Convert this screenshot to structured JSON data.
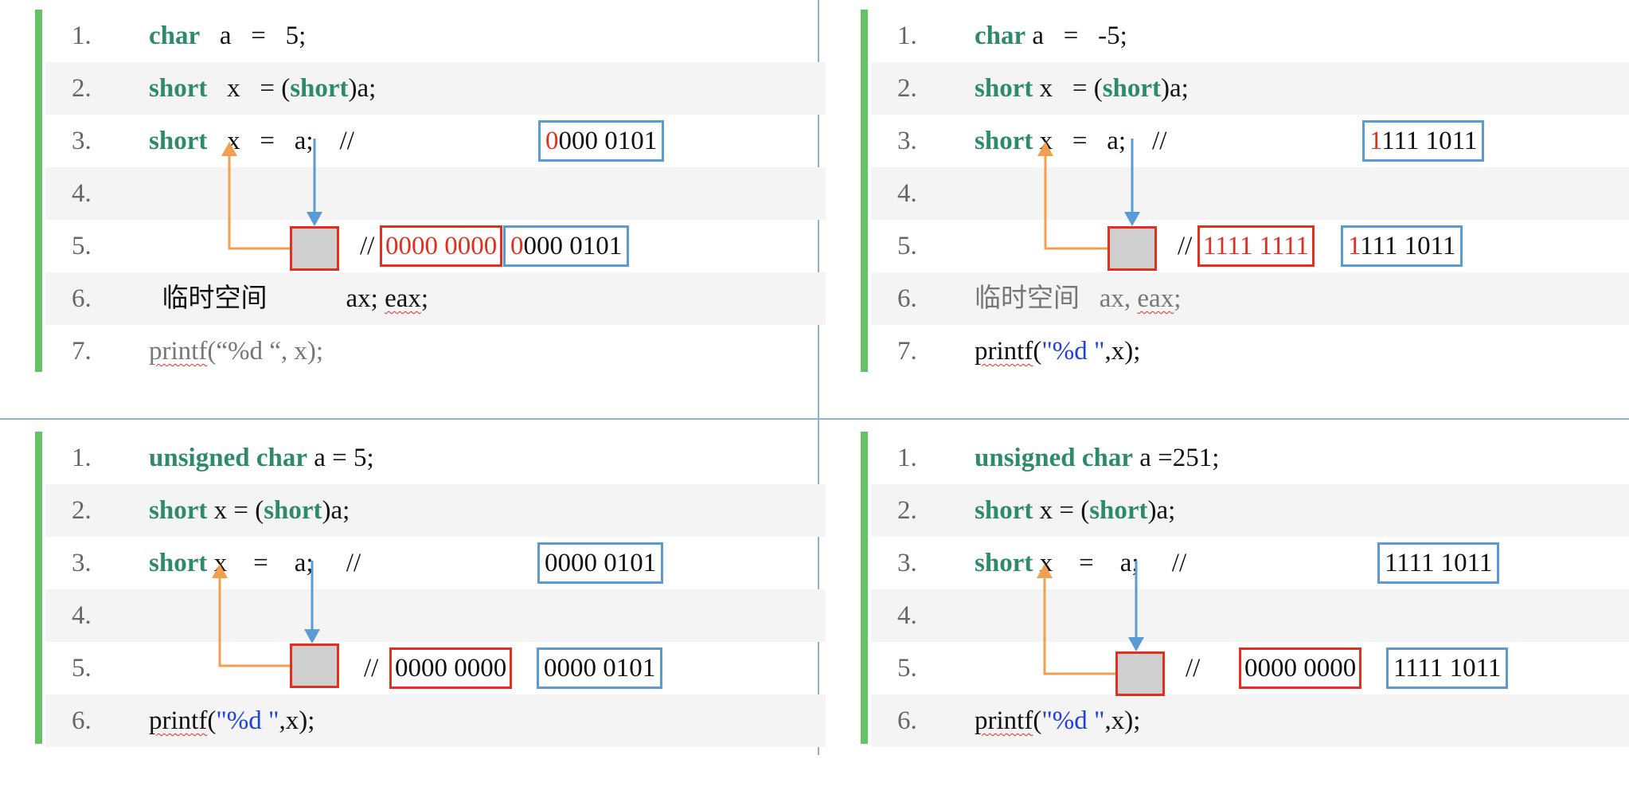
{
  "panels": [
    {
      "lines": [
        {
          "n": "1.",
          "parts": [
            {
              "t": "char",
              "k": "kw"
            },
            {
              "t": "   a   =   5;"
            }
          ]
        },
        {
          "n": "2.",
          "parts": [
            {
              "t": "short",
              "k": "kw"
            },
            {
              "t": "   x   = ("
            },
            {
              "t": "short",
              "k": "kw"
            },
            {
              "t": ")a;"
            }
          ]
        },
        {
          "n": "3.",
          "parts": [
            {
              "t": "short",
              "k": "kw"
            },
            {
              "t": "   x   =   a;    //"
            }
          ]
        },
        {
          "n": "4.",
          "parts": []
        },
        {
          "n": "5.",
          "parts": [
            {
              "t": "//"
            }
          ]
        },
        {
          "n": "6.",
          "parts": [
            {
              "t": "  临时空间            ax; "
            },
            {
              "t": "eax",
              "k": "wavy"
            },
            {
              "t": ";"
            }
          ]
        },
        {
          "n": "7.",
          "parts": [
            {
              "t": "printf",
              "k": "gray wavy"
            },
            {
              "t": "(“%d “, x);",
              "k": "gray"
            }
          ]
        }
      ],
      "line3_box": [
        {
          "t": "0",
          "c": "red"
        },
        {
          "t": "000 0101"
        }
      ],
      "line5_red_box": "0000 0000",
      "line5_blue_box": [
        {
          "t": "0",
          "c": "red"
        },
        {
          "t": "000 0101"
        }
      ]
    },
    {
      "lines": [
        {
          "n": "1.",
          "parts": [
            {
              "t": "char",
              "k": "kw"
            },
            {
              "t": " a   =   -5;"
            }
          ]
        },
        {
          "n": "2.",
          "parts": [
            {
              "t": "short",
              "k": "kw"
            },
            {
              "t": " x   = ("
            },
            {
              "t": "short",
              "k": "kw"
            },
            {
              "t": ")a;"
            }
          ]
        },
        {
          "n": "3.",
          "parts": [
            {
              "t": "short",
              "k": "kw"
            },
            {
              "t": " x   =   a;    //"
            }
          ]
        },
        {
          "n": "4.",
          "parts": []
        },
        {
          "n": "5.",
          "parts": [
            {
              "t": "//"
            }
          ]
        },
        {
          "n": "6.",
          "parts": [
            {
              "t": "临时空间   ax, ",
              "k": "gray"
            },
            {
              "t": "eax",
              "k": "gray wavy"
            },
            {
              "t": ";",
              "k": "gray"
            }
          ]
        },
        {
          "n": "7.",
          "parts": [
            {
              "t": "printf",
              "k": "wavy"
            },
            {
              "t": "("
            },
            {
              "t": "\"%d \"",
              "k": "str"
            },
            {
              "t": ",x);"
            }
          ]
        }
      ],
      "line3_box": [
        {
          "t": "1",
          "c": "red"
        },
        {
          "t": "111 1011"
        }
      ],
      "line5_red_box": "1111 1111",
      "line5_blue_box": [
        {
          "t": "1",
          "c": "red"
        },
        {
          "t": "111 1011"
        }
      ]
    },
    {
      "lines": [
        {
          "n": "1.",
          "parts": [
            {
              "t": "unsigned char",
              "k": "kw"
            },
            {
              "t": " a = 5;"
            }
          ]
        },
        {
          "n": "2.",
          "parts": [
            {
              "t": "short",
              "k": "kw"
            },
            {
              "t": " x = ("
            },
            {
              "t": "short",
              "k": "kw"
            },
            {
              "t": ")a;"
            }
          ]
        },
        {
          "n": "3.",
          "parts": [
            {
              "t": "short",
              "k": "kw"
            },
            {
              "t": " x    =    a;     //"
            }
          ]
        },
        {
          "n": "4.",
          "parts": []
        },
        {
          "n": "5.",
          "parts": [
            {
              "t": "//"
            }
          ]
        },
        {
          "n": "6.",
          "parts": [
            {
              "t": "printf",
              "k": "wavy"
            },
            {
              "t": "("
            },
            {
              "t": "\"%d \"",
              "k": "str"
            },
            {
              "t": ",x);"
            }
          ]
        }
      ],
      "line3_box": [
        {
          "t": "0000 0101"
        }
      ],
      "line5_red_box": "0000 0000",
      "line5_blue_box": [
        {
          "t": "0000 0101"
        }
      ]
    },
    {
      "lines": [
        {
          "n": "1.",
          "parts": [
            {
              "t": "unsigned char",
              "k": "kw"
            },
            {
              "t": " a =251;"
            }
          ]
        },
        {
          "n": "2.",
          "parts": [
            {
              "t": "short",
              "k": "kw"
            },
            {
              "t": " x = ("
            },
            {
              "t": "short",
              "k": "kw"
            },
            {
              "t": ")a;"
            }
          ]
        },
        {
          "n": "3.",
          "parts": [
            {
              "t": "short",
              "k": "kw"
            },
            {
              "t": " x    =    a;     //"
            }
          ]
        },
        {
          "n": "4.",
          "parts": []
        },
        {
          "n": "5.",
          "parts": [
            {
              "t": "//"
            }
          ]
        },
        {
          "n": "6.",
          "parts": [
            {
              "t": "printf",
              "k": "wavy"
            },
            {
              "t": "("
            },
            {
              "t": "\"%d \"",
              "k": "str"
            },
            {
              "t": ",x);"
            }
          ]
        }
      ],
      "line3_box": [
        {
          "t": "1111 1011"
        }
      ],
      "line5_red_box": "0000 0000",
      "line5_blue_box": [
        {
          "t": "1111 1011"
        }
      ]
    }
  ],
  "colors": {
    "keyword": "#2e8b6a",
    "string": "#1f3fe0",
    "accent_bar": "#66c266",
    "box_blue": "#5b9bd5",
    "box_red": "#e03020",
    "arrow_orange": "#f0a050",
    "arrow_blue": "#5b9bd5"
  }
}
